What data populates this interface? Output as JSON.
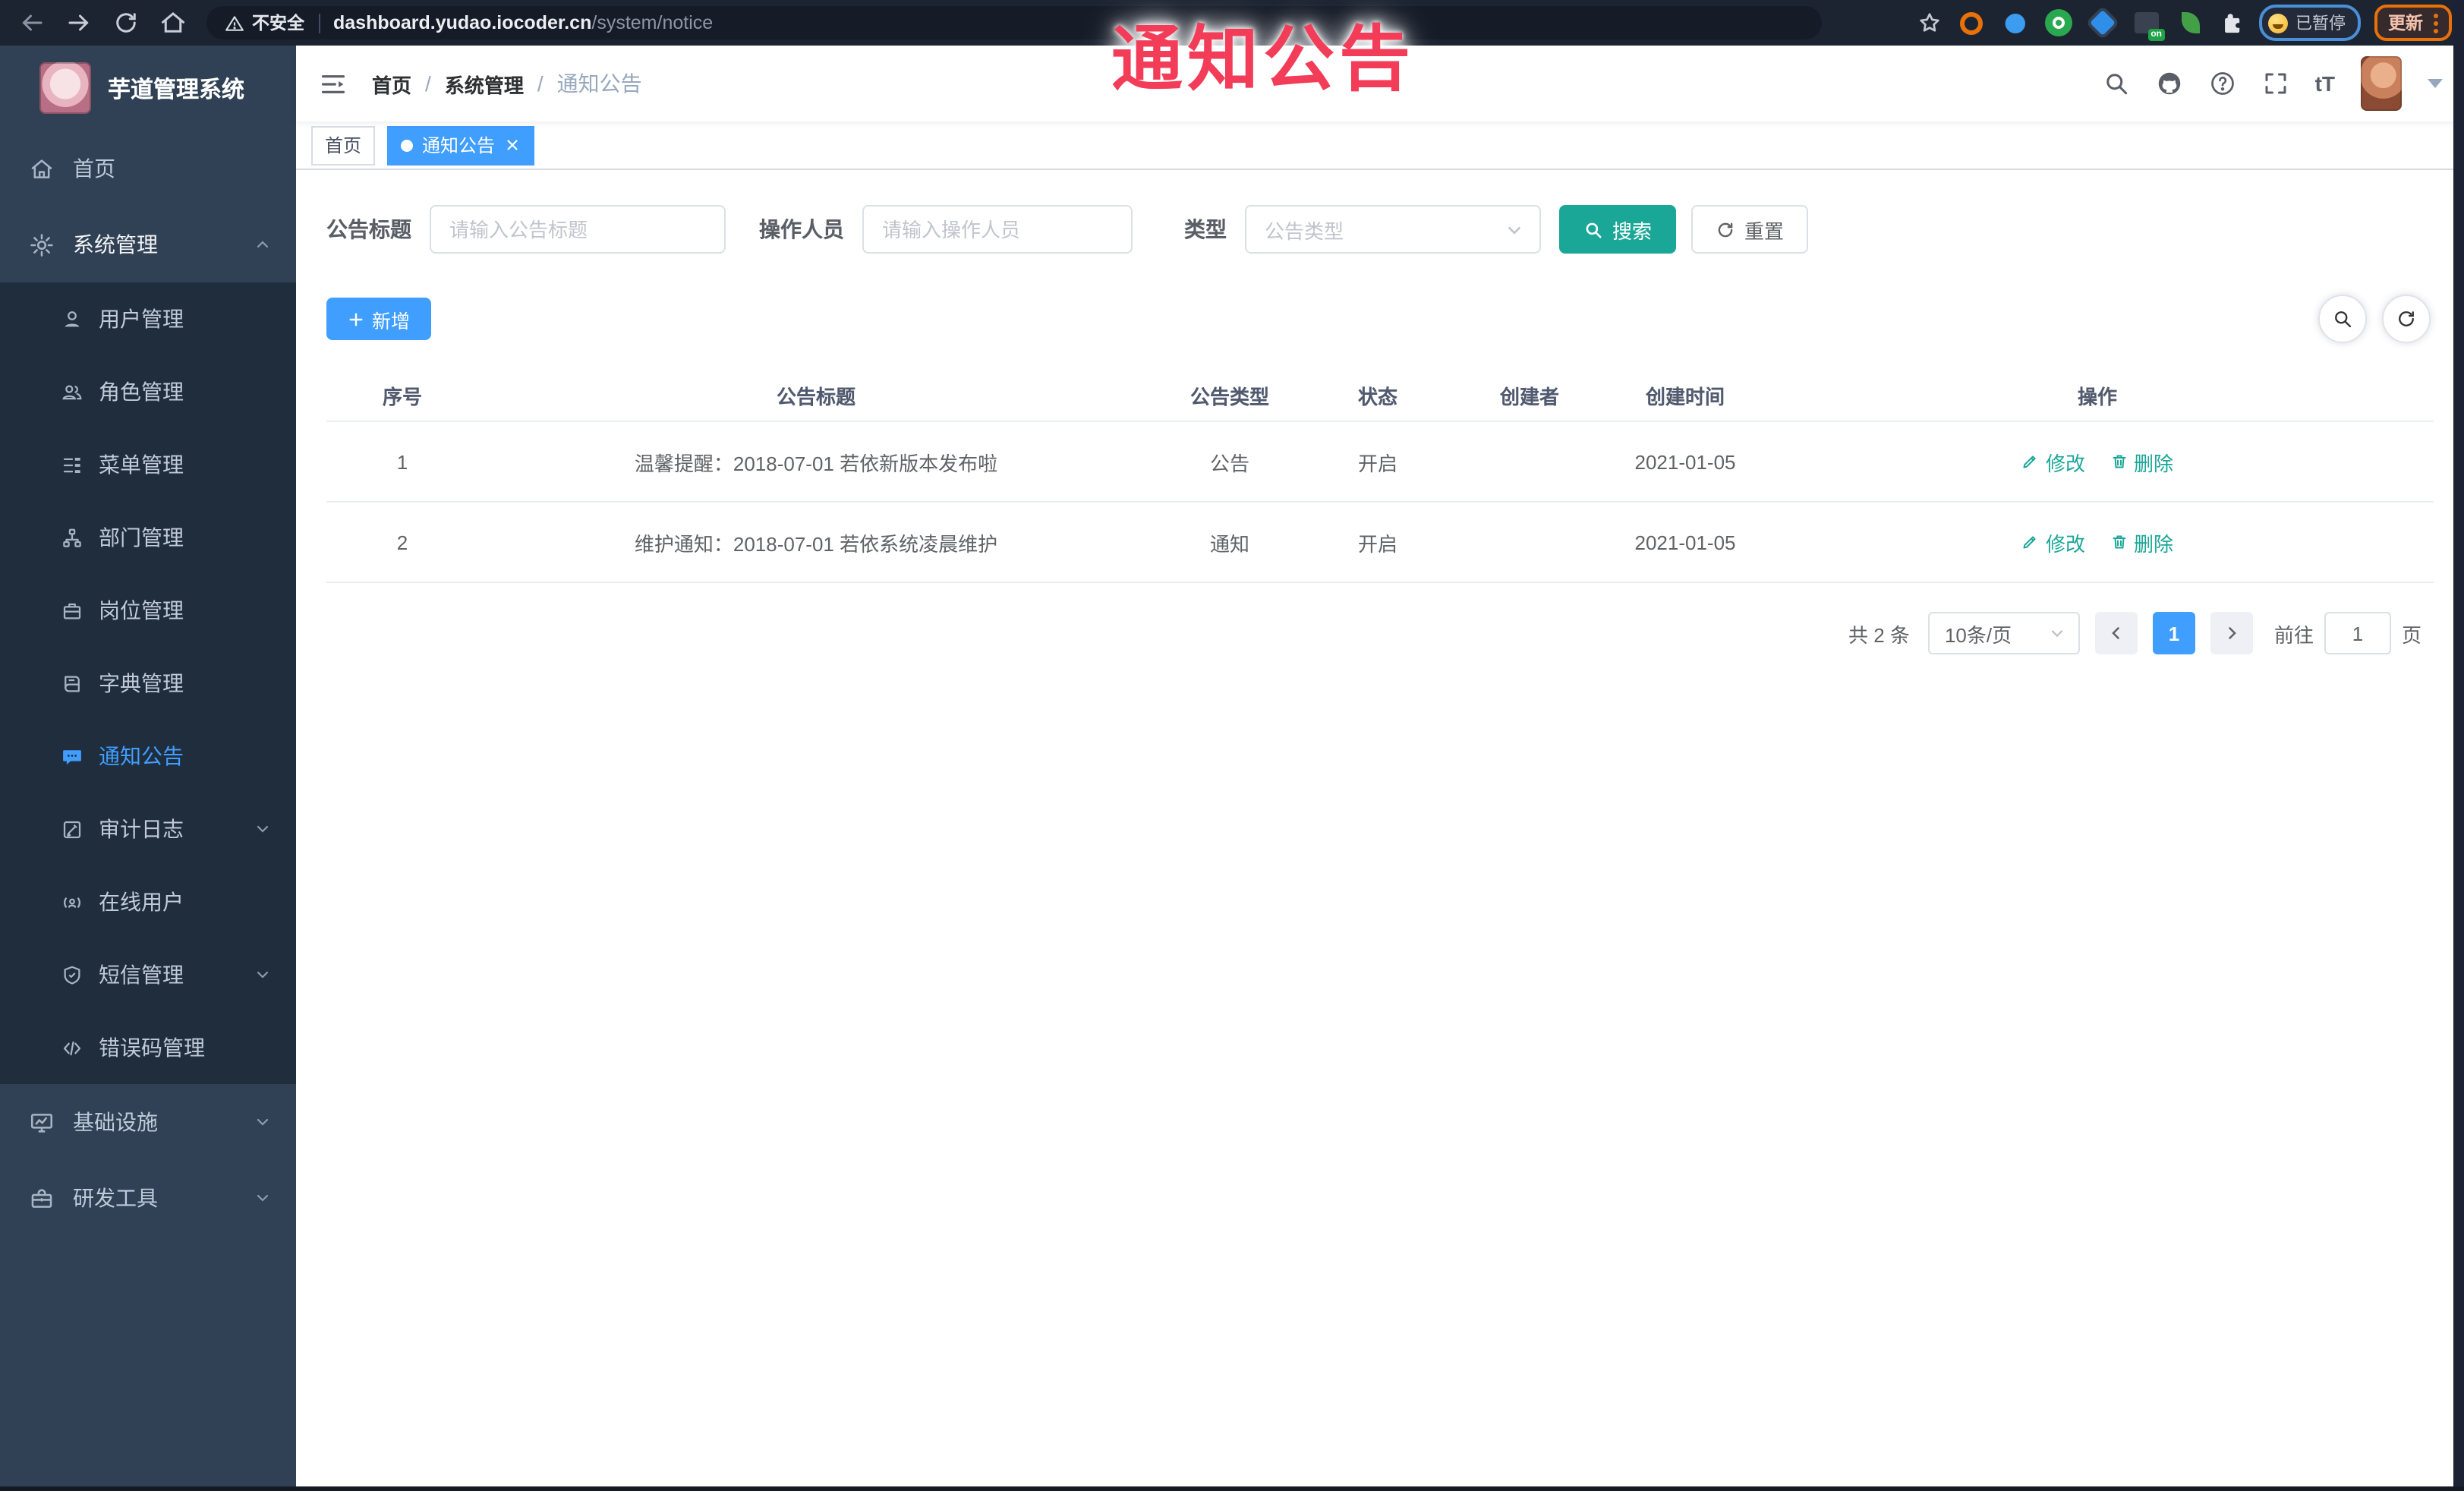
{
  "colors": {
    "accent": "#409eff",
    "teal": "#1aa797",
    "sidebar_bg": "#304156",
    "submenu_bg": "#1f2d3d",
    "chrome_bg": "#1d2431"
  },
  "browser": {
    "security_label": "不安全",
    "url_host": "dashboard.yudao.iocoder.cn",
    "url_path": "/system/notice",
    "extension_on_badge": "on",
    "paused_label": "已暂停",
    "update_label": "更新"
  },
  "annotation": {
    "text": "通知公告"
  },
  "sidebar": {
    "app_title": "芋道管理系统",
    "home": "首页",
    "system": "系统管理",
    "sub": [
      "用户管理",
      "角色管理",
      "菜单管理",
      "部门管理",
      "岗位管理",
      "字典管理",
      "通知公告",
      "审计日志",
      "在线用户",
      "短信管理",
      "错误码管理"
    ],
    "infra": "基础设施",
    "devtools": "研发工具"
  },
  "navbar": {
    "breadcrumb": [
      "首页",
      "系统管理",
      "通知公告"
    ],
    "font_icon": "tT"
  },
  "tabs": {
    "home": "首页",
    "active": "通知公告"
  },
  "filters": {
    "title_label": "公告标题",
    "title_placeholder": "请输入公告标题",
    "operator_label": "操作人员",
    "operator_placeholder": "请输入操作人员",
    "type_label": "类型",
    "type_placeholder": "公告类型",
    "search_label": "搜索",
    "reset_label": "重置"
  },
  "toolbar": {
    "add_label": "新增"
  },
  "table": {
    "columns": [
      "序号",
      "公告标题",
      "公告类型",
      "状态",
      "创建者",
      "创建时间",
      "操作"
    ],
    "rows": [
      {
        "no": "1",
        "title": "温馨提醒：2018-07-01 若依新版本发布啦",
        "type": "公告",
        "status": "开启",
        "creator": "",
        "time": "2021-01-05"
      },
      {
        "no": "2",
        "title": "维护通知：2018-07-01 若依系统凌晨维护",
        "type": "通知",
        "status": "开启",
        "creator": "",
        "time": "2021-01-05"
      }
    ],
    "edit_label": "修改",
    "delete_label": "删除"
  },
  "pagination": {
    "total": "共 2 条",
    "size": "10条/页",
    "page": "1",
    "goto": "前往",
    "goto_value": "1",
    "unit": "页"
  }
}
